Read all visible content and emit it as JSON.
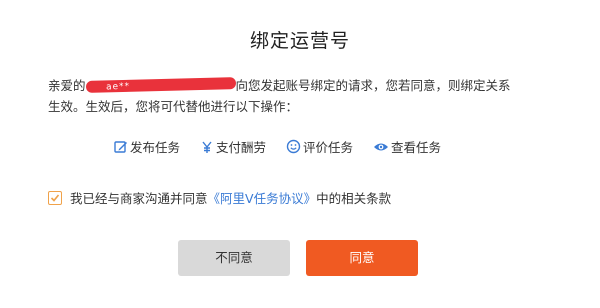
{
  "dialog": {
    "title": "绑定运营号",
    "message": {
      "prefix": "亲爱的",
      "redacted_text": "ae**",
      "suffix_line1": "向您发起账号绑定的请求，您若同意，则绑定关系",
      "line2": "生效。生效后，您将可代替他进行以下操作："
    },
    "actions": [
      {
        "icon": "edit-icon",
        "label": "发布任务"
      },
      {
        "icon": "yen-icon",
        "label": "支付酬劳"
      },
      {
        "icon": "smile-icon",
        "label": "评价任务"
      },
      {
        "icon": "eye-icon",
        "label": "查看任务"
      }
    ],
    "agreement": {
      "checked": true,
      "prefix": "我已经与商家沟通并同意",
      "link_text": "《阿里V任务协议》",
      "suffix": "中的相关条款"
    },
    "buttons": {
      "disagree": "不同意",
      "agree": "同意"
    }
  },
  "colors": {
    "action_icon": "#3a7bd5",
    "checkbox": "#f0a24a",
    "agree_button": "#f05a22",
    "disagree_button": "#d9d9d9",
    "link": "#3a7bd5",
    "redaction": "#e8212b"
  }
}
